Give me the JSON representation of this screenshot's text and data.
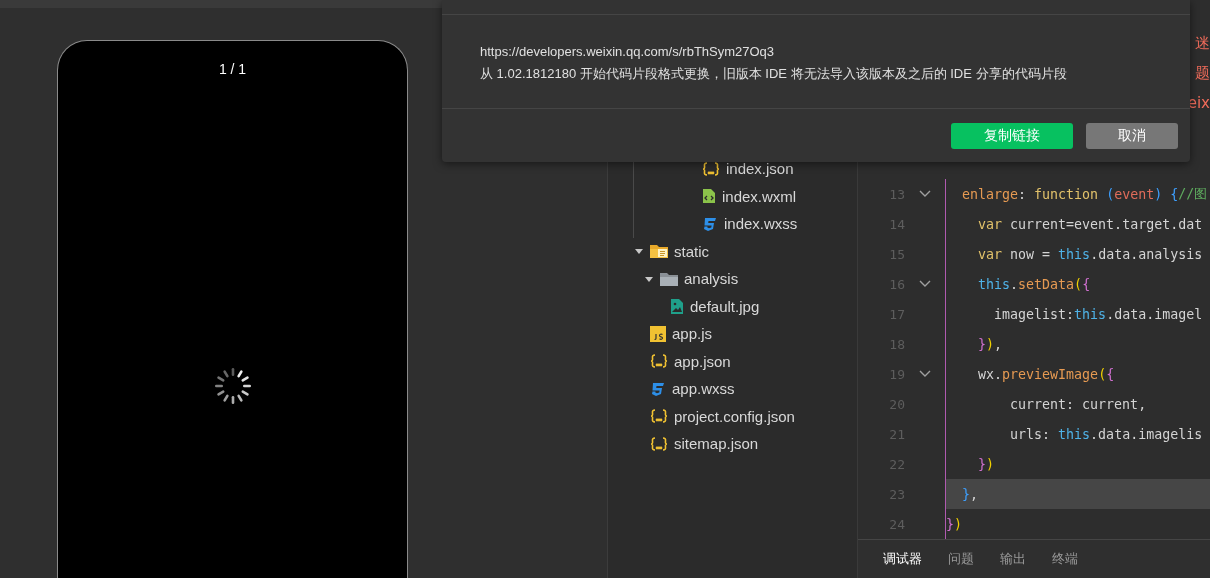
{
  "simulator": {
    "page_counter": "1 / 1"
  },
  "file_tree": [
    {
      "kind": "group",
      "children": [
        {
          "label": "index.json",
          "kind": "json"
        },
        {
          "label": "index.wxml",
          "kind": "wxml"
        },
        {
          "label": "index.wxss",
          "kind": "wxss"
        }
      ]
    },
    {
      "label": "static",
      "kind": "special-folder",
      "expanded": true,
      "children": [
        {
          "label": "analysis",
          "kind": "folder",
          "expanded": true,
          "children": [
            {
              "label": "default.jpg",
              "kind": "image"
            }
          ]
        }
      ]
    },
    {
      "label": "app.js",
      "kind": "js"
    },
    {
      "label": "app.json",
      "kind": "json"
    },
    {
      "label": "app.wxss",
      "kind": "wxss"
    },
    {
      "label": "project.config.json",
      "kind": "json"
    },
    {
      "label": "sitemap.json",
      "kind": "json"
    }
  ],
  "editor": {
    "notices": [
      "迷",
      "题",
      "eix"
    ],
    "lines": [
      {
        "number": "13",
        "foldable": true,
        "current": false,
        "tokens": [
          {
            "text": "  enlarge",
            "kind": "fn"
          },
          {
            "text": ": ",
            "kind": "plain"
          },
          {
            "text": "function ",
            "kind": "kw"
          },
          {
            "text": "(",
            "kind": "b3"
          },
          {
            "text": "event",
            "kind": "param"
          },
          {
            "text": ") ",
            "kind": "b3"
          },
          {
            "text": "{",
            "kind": "b3"
          },
          {
            "text": "//图",
            "kind": "comment"
          }
        ]
      },
      {
        "number": "14",
        "foldable": false,
        "current": false,
        "tokens": [
          {
            "text": "    var",
            "kind": "kw"
          },
          {
            "text": " current=event.target.dat",
            "kind": "plain"
          }
        ]
      },
      {
        "number": "15",
        "foldable": false,
        "current": false,
        "tokens": [
          {
            "text": "    var",
            "kind": "kw"
          },
          {
            "text": " now = ",
            "kind": "plain"
          },
          {
            "text": "this",
            "kind": "this"
          },
          {
            "text": ".data.analysis",
            "kind": "plain"
          }
        ]
      },
      {
        "number": "16",
        "foldable": true,
        "current": false,
        "tokens": [
          {
            "text": "    this",
            "kind": "this"
          },
          {
            "text": ".",
            "kind": "plain"
          },
          {
            "text": "setData",
            "kind": "fn"
          },
          {
            "text": "(",
            "kind": "b1"
          },
          {
            "text": "{",
            "kind": "b2"
          }
        ]
      },
      {
        "number": "17",
        "foldable": false,
        "current": false,
        "tokens": [
          {
            "text": "      imagelist:",
            "kind": "plain"
          },
          {
            "text": "this",
            "kind": "this"
          },
          {
            "text": ".data.imagel",
            "kind": "plain"
          }
        ]
      },
      {
        "number": "18",
        "foldable": false,
        "current": false,
        "tokens": [
          {
            "text": "    }",
            "kind": "b2"
          },
          {
            "text": ")",
            "kind": "b1"
          },
          {
            "text": ",",
            "kind": "plain"
          }
        ]
      },
      {
        "number": "19",
        "foldable": true,
        "current": false,
        "tokens": [
          {
            "text": "    wx.",
            "kind": "plain"
          },
          {
            "text": "previewImage",
            "kind": "fn"
          },
          {
            "text": "(",
            "kind": "b1"
          },
          {
            "text": "{",
            "kind": "b2"
          }
        ]
      },
      {
        "number": "20",
        "foldable": false,
        "current": false,
        "tokens": [
          {
            "text": "        current: current,",
            "kind": "plain"
          }
        ]
      },
      {
        "number": "21",
        "foldable": false,
        "current": false,
        "tokens": [
          {
            "text": "        urls: ",
            "kind": "plain"
          },
          {
            "text": "this",
            "kind": "this"
          },
          {
            "text": ".data.imagelis",
            "kind": "plain"
          }
        ]
      },
      {
        "number": "22",
        "foldable": false,
        "current": false,
        "tokens": [
          {
            "text": "    }",
            "kind": "b2"
          },
          {
            "text": ")",
            "kind": "b1"
          }
        ]
      },
      {
        "number": "23",
        "foldable": false,
        "current": true,
        "tokens": [
          {
            "text": "  }",
            "kind": "b3"
          },
          {
            "text": ",",
            "kind": "plain"
          }
        ]
      },
      {
        "number": "24",
        "foldable": false,
        "current": false,
        "tokens": [
          {
            "text": "}",
            "kind": "b2"
          },
          {
            "text": ")",
            "kind": "b1"
          }
        ]
      }
    ]
  },
  "bottom_tabs": [
    {
      "label": "调试器",
      "selected": true
    },
    {
      "label": "问题",
      "selected": false
    },
    {
      "label": "输出",
      "selected": false
    },
    {
      "label": "终端",
      "selected": false
    }
  ],
  "dialog": {
    "link": "https://developers.weixin.qq.com/s/rbThSym27Oq3",
    "message": "从 1.02.1812180 开始代码片段格式更换，旧版本 IDE 将无法导入该版本及之后的 IDE 分享的代码片段",
    "buttons": [
      {
        "label": "复制链接",
        "kind": "primary"
      },
      {
        "label": "取消",
        "kind": "secondary"
      }
    ]
  }
}
